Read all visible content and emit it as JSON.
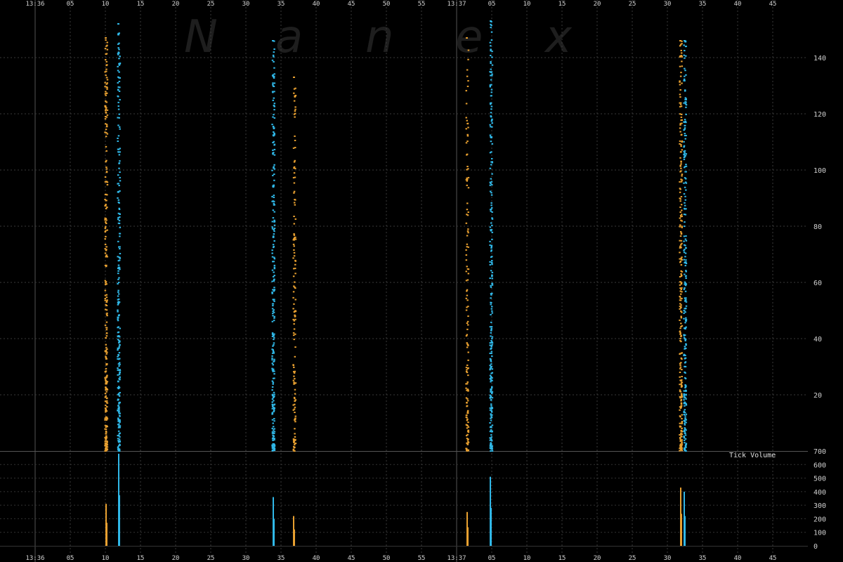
{
  "chart_data": [
    {
      "type": "scatter",
      "title": "",
      "xlabel": "",
      "ylabel": "",
      "x_tick_labels": [
        "13:36",
        "05",
        "10",
        "15",
        "20",
        "25",
        "30",
        "35",
        "40",
        "45",
        "50",
        "55",
        "13:37",
        "05",
        "10",
        "15",
        "20",
        "25",
        "30",
        "35",
        "40",
        "45"
      ],
      "ylim": [
        0,
        150
      ],
      "y_ticks": [
        20,
        40,
        60,
        80,
        100,
        120,
        140
      ],
      "grid": true,
      "colors": {
        "orange": "#e8a030",
        "blue": "#30b8e8"
      },
      "bursts": [
        {
          "second": 10.0,
          "color": "orange",
          "y_range": [
            0,
            147
          ],
          "density": "dense"
        },
        {
          "second": 11.8,
          "color": "blue",
          "y_range": [
            0,
            152
          ],
          "density": "dense"
        },
        {
          "second": 33.8,
          "color": "blue",
          "y_range": [
            0,
            146
          ],
          "density": "dense"
        },
        {
          "second": 36.8,
          "color": "orange",
          "y_range": [
            0,
            133
          ],
          "density": "medium"
        },
        {
          "second": 61.4,
          "color": "orange",
          "y_range": [
            0,
            147
          ],
          "density": "medium"
        },
        {
          "second": 64.8,
          "color": "blue",
          "y_range": [
            0,
            153
          ],
          "density": "dense"
        },
        {
          "second": 91.8,
          "color": "orange",
          "y_range": [
            0,
            146
          ],
          "density": "dense"
        },
        {
          "second": 92.4,
          "color": "blue",
          "y_range": [
            0,
            146
          ],
          "density": "dense"
        }
      ]
    },
    {
      "type": "bar",
      "title": "Tick Volume",
      "ylim": [
        0,
        700
      ],
      "y_ticks": [
        0,
        100,
        200,
        300,
        400,
        500,
        600,
        700
      ],
      "bars": [
        {
          "second": 10.1,
          "color": "orange",
          "value": 310
        },
        {
          "second": 11.9,
          "color": "blue",
          "value": 680
        },
        {
          "second": 33.9,
          "color": "blue",
          "value": 360
        },
        {
          "second": 36.8,
          "color": "orange",
          "value": 220
        },
        {
          "second": 61.5,
          "color": "orange",
          "value": 250
        },
        {
          "second": 64.8,
          "color": "blue",
          "value": 510
        },
        {
          "second": 91.9,
          "color": "orange",
          "value": 430
        },
        {
          "second": 92.4,
          "color": "blue",
          "value": 400
        }
      ]
    }
  ],
  "watermark": [
    "N",
    "a",
    "n",
    "e",
    "x"
  ]
}
